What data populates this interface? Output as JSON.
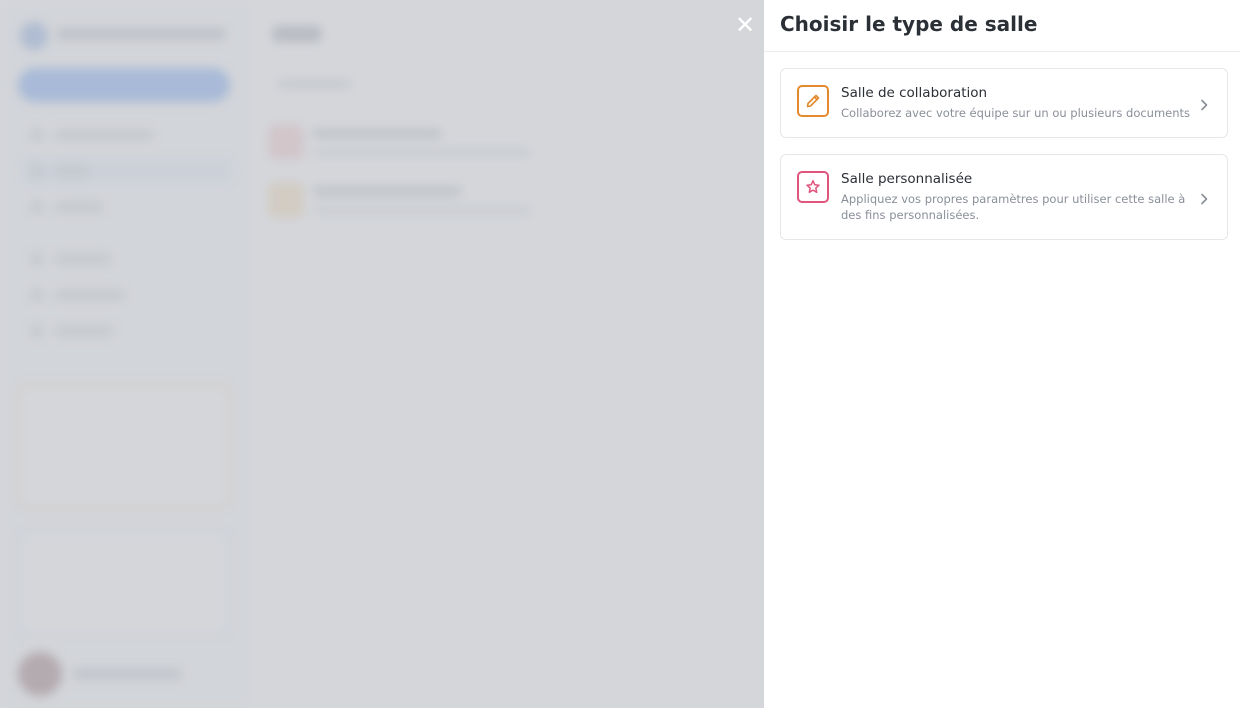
{
  "drawer": {
    "title": "Choisir le type de salle",
    "close_icon": "close-icon",
    "options": [
      {
        "title": "Salle de collaboration",
        "description": "Collaborez avec votre équipe sur un ou plusieurs documents",
        "icon": "pencil-icon",
        "accent": "#e38a2e"
      },
      {
        "title": "Salle personnalisée",
        "description": "Appliquez vos propres paramètres pour utiliser cette salle à des fins personnalisées.",
        "icon": "star-icon",
        "accent": "#e0557d"
      }
    ]
  },
  "colors": {
    "overlay": "#c8cbd0",
    "primary": "#3b82f6",
    "text": "#2b2f36",
    "muted": "#8a8f98"
  }
}
